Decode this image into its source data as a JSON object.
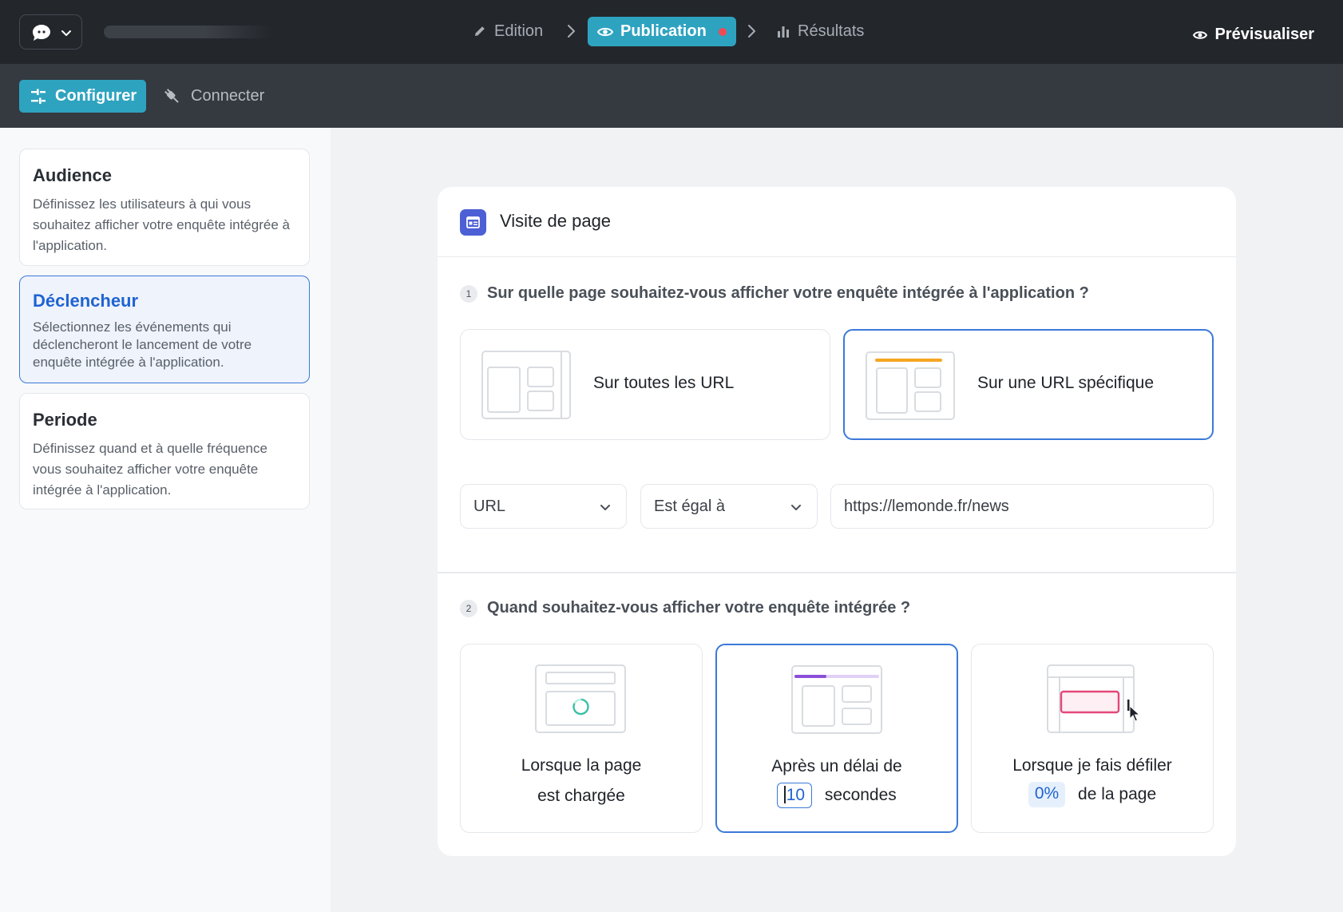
{
  "topbar": {
    "logo_icon": "chat-bubble-icon",
    "steps": [
      {
        "label": "Edition",
        "icon": "pencil-icon"
      },
      {
        "label": "Publication",
        "icon": "eye-icon"
      },
      {
        "label": "Résultats",
        "icon": "bar-chart-icon"
      }
    ],
    "preview_label": "Prévisualiser"
  },
  "subbar": {
    "configure_label": "Configurer",
    "connect_label": "Connecter"
  },
  "sidebar": {
    "items": [
      {
        "title": "Audience",
        "description": "Définissez les utilisateurs à qui vous souhaitez afficher votre enquête intégrée à l'application."
      },
      {
        "title": "Déclencheur",
        "description": "Sélectionnez les événements qui déclencheront le lancement de votre enquête intégrée à l'application."
      },
      {
        "title": "Periode",
        "description": "Définissez quand et à quelle fréquence vous souhaitez afficher votre enquête intégrée à l'application."
      }
    ]
  },
  "panel": {
    "title": "Visite de page",
    "question1": {
      "number": "1",
      "text": "Sur quelle page souhaitez-vous afficher votre enquête intégrée à l'application ?"
    },
    "url_options": [
      {
        "label": "Sur toutes les URL"
      },
      {
        "label": "Sur une URL spécifique"
      }
    ],
    "url_rule": {
      "field": "URL",
      "operator": "Est égal à",
      "value": "https://lemonde.fr/news"
    },
    "question2": {
      "number": "2",
      "text": "Quand souhaitez-vous afficher votre enquête intégrée ?"
    },
    "timing_options": {
      "on_load": {
        "line1": "Lorsque la page",
        "line2": "est chargée"
      },
      "delay": {
        "line1": "Après un délai de",
        "value": "10",
        "suffix": "secondes"
      },
      "scroll": {
        "line1": "Lorsque je fais défiler",
        "value": "0%",
        "suffix": "de la page"
      }
    }
  },
  "colors": {
    "accent": "#2ea3c0",
    "selected_border": "#3b79d9",
    "notification_dot": "#ef4a55"
  }
}
